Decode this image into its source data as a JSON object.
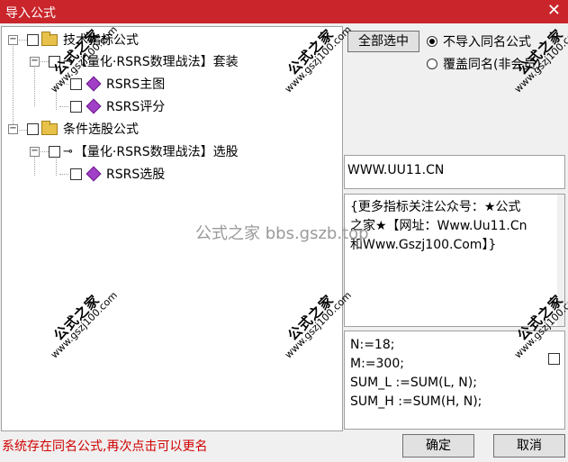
{
  "window": {
    "title": "导入公式",
    "close_glyph": "✕"
  },
  "tree": {
    "groups": [
      {
        "label": "技术指标公式",
        "expander": "−",
        "child": {
          "label": "【量化·RSRS数理战法】套装",
          "items": [
            "RSRS主图",
            "RSRS评分"
          ]
        }
      },
      {
        "label": "条件选股公式",
        "expander": "−",
        "child": {
          "label": "【量化·RSRS数理战法】选股",
          "items": [
            "RSRS选股"
          ]
        }
      }
    ]
  },
  "actions": {
    "select_all": "全部选中",
    "ok": "确定",
    "cancel": "取消"
  },
  "options": [
    {
      "label": "不导入同名公式",
      "selected": true
    },
    {
      "label": "覆盖同名(非会员)",
      "selected": false
    }
  ],
  "info": {
    "url_text": "WWW.UU11.CN",
    "description_lines": [
      "{更多指标关注公众号：★公式",
      "之家★【网址：Www.Uu11.Cn",
      "和Www.Gszj100.Com】}"
    ],
    "code_lines": [
      "N:=18;",
      "M:=300;",
      "SUM_L :=SUM(L, N);",
      "SUM_H :=SUM(H, N);"
    ]
  },
  "status_text": "系统存在同名公式,再次点击可以更名",
  "watermark": {
    "site_name": "公式之家",
    "site_url": "www.gszj100.com",
    "center_text": "公式之家 bbs.gszb.top"
  },
  "colors": {
    "titlebar": "#c9252b",
    "status": "#d00000"
  }
}
